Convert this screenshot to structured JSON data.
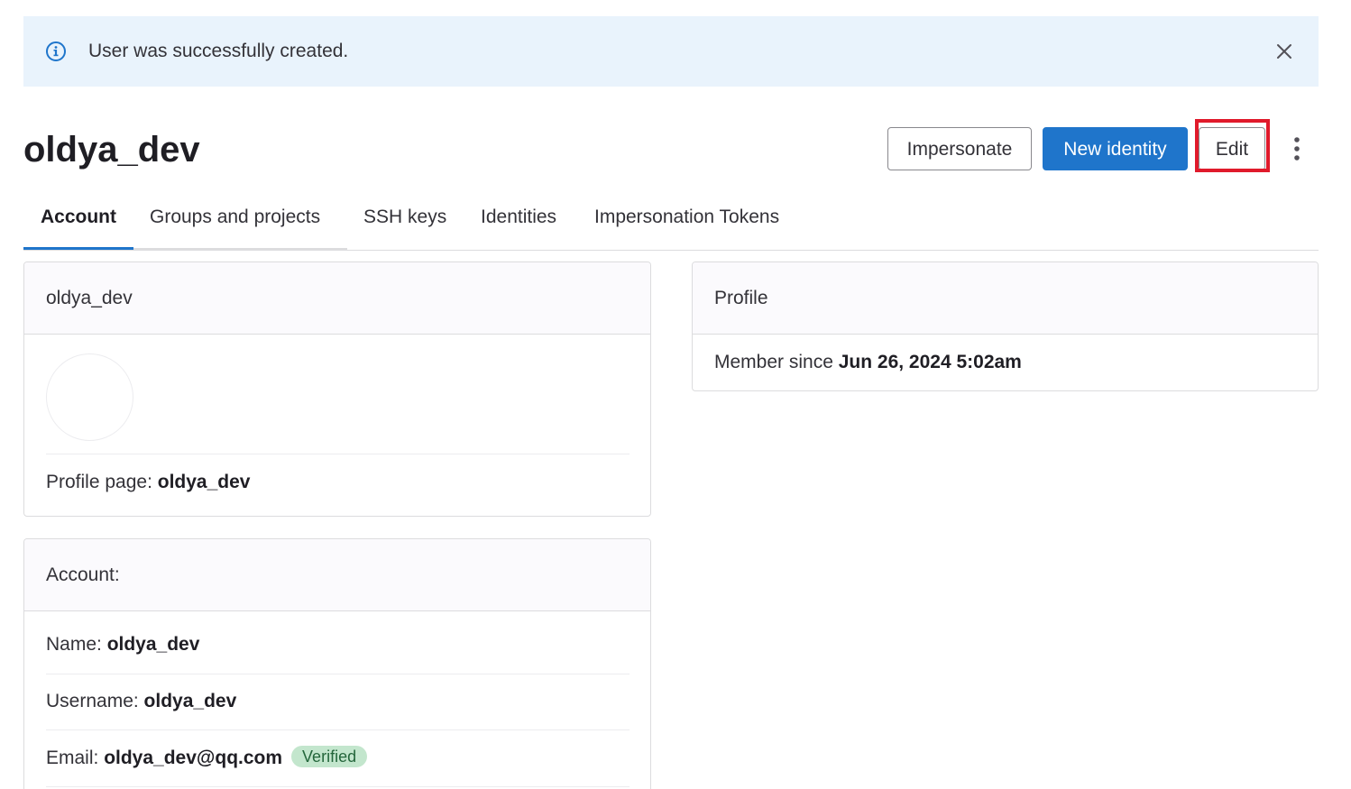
{
  "alert": {
    "message": "User was successfully created.",
    "icon": "info-icon",
    "close_icon": "close-icon"
  },
  "page": {
    "title": "oldya_dev"
  },
  "actions": {
    "impersonate_label": "Impersonate",
    "new_identity_label": "New identity",
    "edit_label": "Edit",
    "more_icon": "kebab-menu-icon"
  },
  "tabs": [
    {
      "label": "Account",
      "active": true
    },
    {
      "label": "Groups and projects",
      "active": false
    },
    {
      "label": "SSH keys",
      "active": false
    },
    {
      "label": "Identities",
      "active": false
    },
    {
      "label": "Impersonation Tokens",
      "active": false
    }
  ],
  "user_card": {
    "header": "oldya_dev",
    "profile_page_label": "Profile page: ",
    "profile_page_value": "oldya_dev"
  },
  "profile_card": {
    "header": "Profile",
    "member_since_label": "Member since ",
    "member_since_value": "Jun 26, 2024 5:02am"
  },
  "account_card": {
    "header": "Account:",
    "name_label": "Name: ",
    "name_value": "oldya_dev",
    "username_label": "Username: ",
    "username_value": "oldya_dev",
    "email_label": "Email: ",
    "email_value": "oldya_dev@qq.com",
    "email_badge": "Verified"
  },
  "colors": {
    "primary": "#1f75cb",
    "alert_bg": "#e9f3fc",
    "highlight": "#e01a2b",
    "badge_bg": "#c3e6cd",
    "badge_text": "#24663b"
  }
}
